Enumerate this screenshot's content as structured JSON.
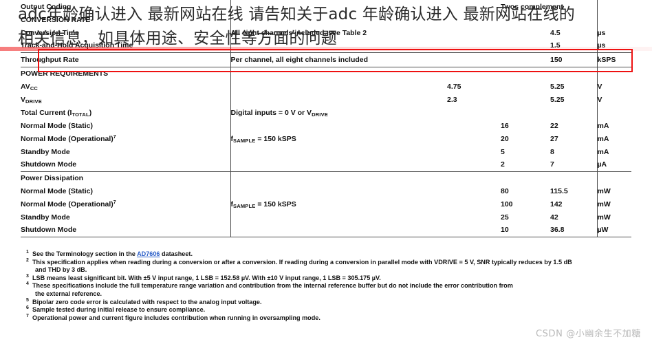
{
  "overlay": {
    "line1": "adc年龄确认进入 最新网站在线 请告知关于adc 年龄确认进入 最新网站在线的",
    "line2": "相关信息，如具体用途、安全性等方面的问题"
  },
  "watermark": "CSDN @小幽余生不加糖",
  "colors": {
    "highlight": "#ee1111",
    "link": "#2b5fc9",
    "rule": "#4d4d4d",
    "watermark": "#b9b9b9"
  },
  "table": {
    "rows": [
      {
        "param": "Output Coding",
        "indent": 1,
        "cond": "",
        "min": "",
        "typ": "Twos complement",
        "max": "",
        "unit": ""
      },
      {
        "param": "CONVERSION RATE",
        "indent": 0,
        "cond": "",
        "min": "",
        "typ": "",
        "max": "",
        "unit": ""
      },
      {
        "param": "Conversion Time",
        "indent": 1,
        "cond": "All eight channels included, see Table 2",
        "min": "",
        "typ": "",
        "max": "4.5",
        "unit": "µs"
      },
      {
        "param": "Track-and-Hold Acquisition Time",
        "indent": 1,
        "cond": "",
        "min": "",
        "typ": "",
        "max": "1.5",
        "unit": "µs"
      },
      {
        "param": "Throughput Rate",
        "indent": 1,
        "cond": "Per channel, all eight channels included",
        "min": "",
        "typ": "",
        "max": "150",
        "unit": "kSPS"
      },
      {
        "param": "POWER REQUIREMENTS",
        "indent": 0,
        "cond": "",
        "min": "",
        "typ": "",
        "max": "",
        "unit": ""
      },
      {
        "param": "AVCC",
        "indent": 1,
        "cond": "",
        "min": "4.75",
        "typ": "",
        "max": "5.25",
        "unit": "V"
      },
      {
        "param": "VDRIVE",
        "indent": 1,
        "cond": "",
        "min": "2.3",
        "typ": "",
        "max": "5.25",
        "unit": "V"
      },
      {
        "param": "Total Current (ITOTAL)",
        "indent": 1,
        "cond": "Digital inputs = 0 V or VDRIVE",
        "min": "",
        "typ": "",
        "max": "",
        "unit": ""
      },
      {
        "param": "Normal Mode (Static)",
        "indent": 2,
        "cond": "",
        "min": "",
        "typ": "16",
        "max": "22",
        "unit": "mA"
      },
      {
        "param": "Normal Mode (Operational)",
        "footnote": "7",
        "indent": 2,
        "cond": "fSAMPLE = 150 kSPS",
        "min": "",
        "typ": "20",
        "max": "27",
        "unit": "mA"
      },
      {
        "param": "Standby Mode",
        "indent": 2,
        "cond": "",
        "min": "",
        "typ": "5",
        "max": "8",
        "unit": "mA"
      },
      {
        "param": "Shutdown Mode",
        "indent": 2,
        "cond": "",
        "min": "",
        "typ": "2",
        "max": "7",
        "unit": "µA"
      },
      {
        "param": "Power Dissipation",
        "indent": 1,
        "cond": "",
        "min": "",
        "typ": "",
        "max": "",
        "unit": ""
      },
      {
        "param": "Normal Mode (Static)",
        "indent": 2,
        "cond": "",
        "min": "",
        "typ": "80",
        "max": "115.5",
        "unit": "mW"
      },
      {
        "param": "Normal Mode (Operational)",
        "footnote": "7",
        "indent": 2,
        "cond": "fSAMPLE = 150 kSPS",
        "min": "",
        "typ": "100",
        "max": "142",
        "unit": "mW"
      },
      {
        "param": "Standby Mode",
        "indent": 2,
        "cond": "",
        "min": "",
        "typ": "25",
        "max": "42",
        "unit": "mW"
      },
      {
        "param": "Shutdown Mode",
        "indent": 2,
        "cond": "",
        "min": "",
        "typ": "10",
        "max": "36.8",
        "unit": "µW"
      }
    ]
  },
  "footnotes": [
    {
      "mark": "1",
      "text_before": "See the Terminology section in the ",
      "link": "AD7606",
      "text_after": " datasheet."
    },
    {
      "mark": "2",
      "text_before": "This specification applies when reading during a conversion or after a conversion. If reading during a conversion in parallel mode with VDRIVE = 5 V, SNR typically reduces by 1.5 dB",
      "cont": "and THD by 3 dB."
    },
    {
      "mark": "3",
      "text_before": "LSB means least significant bit. With ±5 V input range, 1 LSB = 152.58 µV. With ±10 V input range, 1 LSB = 305.175 µV."
    },
    {
      "mark": "4",
      "text_before": "These specifications include the full temperature range variation and contribution from the internal reference buffer but do not include the error contribution from",
      "cont": "the external reference."
    },
    {
      "mark": "5",
      "text_before": "Bipolar zero code error is calculated with respect to the analog input voltage."
    },
    {
      "mark": "6",
      "text_before": "Sample tested during initial release to ensure compliance."
    },
    {
      "mark": "7",
      "text_before": "Operational power and current figure includes contribution when running in oversampling mode."
    }
  ]
}
